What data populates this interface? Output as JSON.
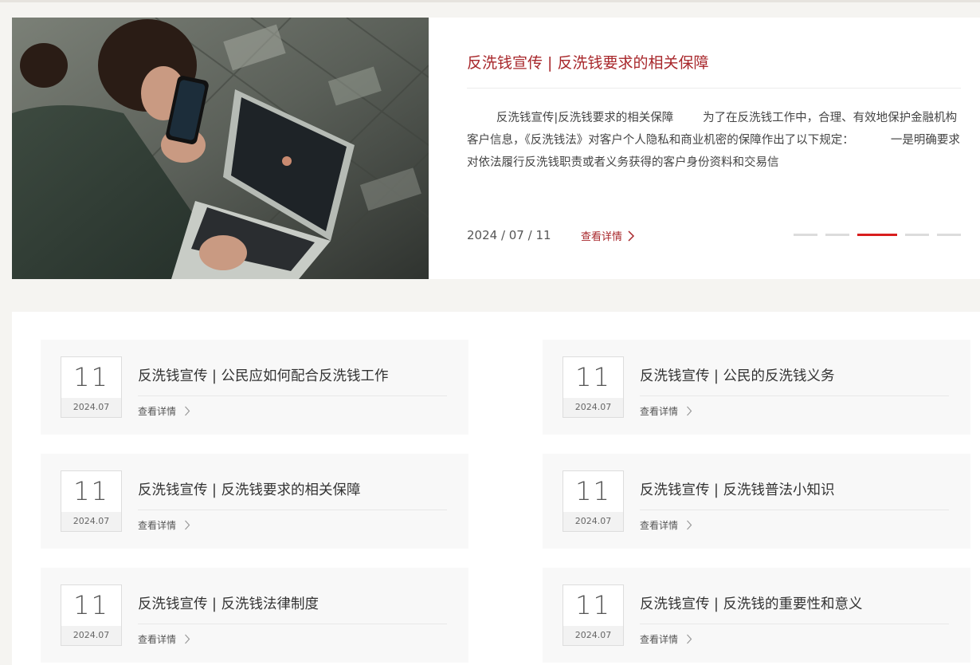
{
  "featured": {
    "title": "反洗钱宣传 | 反洗钱要求的相关保障",
    "summary": "        反洗钱宣传|反洗钱要求的相关保障        为了在反洗钱工作中，合理、有效地保护金融机构客户信息，《反洗钱法》对客户个人隐私和商业机密的保障作出了以下规定：          一是明确要求对依法履行反洗钱职责或者义务获得的客户身份资料和交易信",
    "date": "2024 / 07 / 11",
    "more_label": "查看详情",
    "slides": 5,
    "active_slide": 3
  },
  "news": [
    {
      "day": "11",
      "ym": "2024.07",
      "title": "反洗钱宣传 | 公民应如何配合反洗钱工作",
      "more": "查看详情"
    },
    {
      "day": "11",
      "ym": "2024.07",
      "title": "反洗钱宣传 | 公民的反洗钱义务",
      "more": "查看详情"
    },
    {
      "day": "11",
      "ym": "2024.07",
      "title": "反洗钱宣传 | 反洗钱要求的相关保障",
      "more": "查看详情"
    },
    {
      "day": "11",
      "ym": "2024.07",
      "title": "反洗钱宣传 | 反洗钱普法小知识",
      "more": "查看详情"
    },
    {
      "day": "11",
      "ym": "2024.07",
      "title": "反洗钱宣传 | 反洗钱法律制度",
      "more": "查看详情"
    },
    {
      "day": "11",
      "ym": "2024.07",
      "title": "反洗钱宣传 | 反洗钱的重要性和意义",
      "more": "查看详情"
    }
  ],
  "colors": {
    "accent": "#a8272b",
    "active_dot": "#d81e1e"
  }
}
